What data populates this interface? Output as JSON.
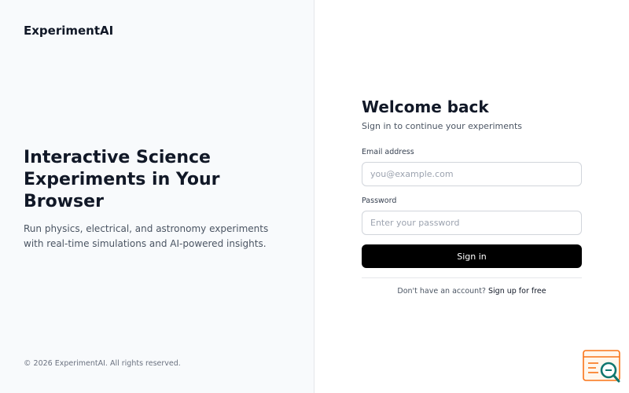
{
  "brand": {
    "name": "ExperimentAI"
  },
  "hero": {
    "title": "Interactive Science Experiments in Your Browser",
    "subtitle": "Run physics, electrical, and astronomy experiments with real-time simulations and AI-powered insights."
  },
  "footer": {
    "copyright": "© 2026 ExperimentAI. All rights reserved."
  },
  "login": {
    "title": "Welcome back",
    "subtitle": "Sign in to continue your experiments",
    "email_label": "Email address",
    "email_placeholder": "you@example.com",
    "email_value": "",
    "password_label": "Password",
    "password_placeholder": "Enter your password",
    "password_value": "",
    "submit_label": "Sign in",
    "signup_prompt": "Don't have an account?",
    "signup_link": "Sign up for free"
  },
  "widget": {
    "icon": "search-help-icon",
    "accent": "#f97316",
    "lens": "#0f766e"
  }
}
